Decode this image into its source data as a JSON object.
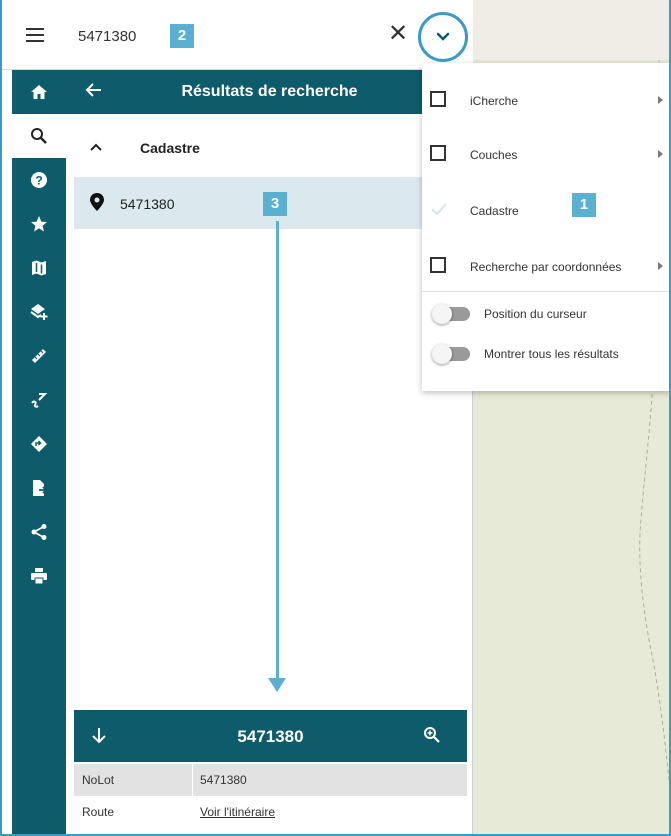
{
  "search": {
    "value": "5471380",
    "menu_icon": "hamburger-icon",
    "clear_icon": "close-icon",
    "dropdown_icon": "chevron-down-icon"
  },
  "annotations": {
    "badge1": "1",
    "badge2": "2",
    "badge3": "3"
  },
  "rail": {
    "items": [
      {
        "icon": "home-icon",
        "active": false
      },
      {
        "icon": "search-icon",
        "active": true
      },
      {
        "icon": "help-icon",
        "active": false
      },
      {
        "icon": "star-icon",
        "active": false
      },
      {
        "icon": "map-icon",
        "active": false
      },
      {
        "icon": "add-layer-icon",
        "active": false
      },
      {
        "icon": "ruler-icon",
        "active": false
      },
      {
        "icon": "draw-icon",
        "active": false
      },
      {
        "icon": "directions-icon",
        "active": false
      },
      {
        "icon": "export-file-icon",
        "active": false
      },
      {
        "icon": "share-icon",
        "active": false
      },
      {
        "icon": "print-icon",
        "active": false
      }
    ]
  },
  "panel": {
    "title": "Résultats de recherche",
    "group_label": "Cadastre",
    "result_label": "5471380"
  },
  "detail": {
    "title": "5471380",
    "rows": [
      {
        "key": "NoLot",
        "value": "5471380"
      },
      {
        "key": "Route",
        "value": "Voir l'itinéraire"
      }
    ]
  },
  "menu": {
    "items": [
      {
        "label": "iCherche",
        "checked": false,
        "submenu": true
      },
      {
        "label": "Couches",
        "checked": false,
        "submenu": true
      },
      {
        "label": "Cadastre",
        "checked": true,
        "submenu": false
      },
      {
        "label": "Recherche par coordonnées",
        "checked": false,
        "submenu": true
      }
    ],
    "toggles": [
      {
        "label": "Position du curseur",
        "on": false
      },
      {
        "label": "Montrer tous les résultats",
        "on": false
      }
    ]
  },
  "colors": {
    "accent": "#0d5b6b",
    "annotation": "#5ab0d0",
    "highlight_row": "#dbe9ef",
    "map_bg": "#e7ead6"
  }
}
